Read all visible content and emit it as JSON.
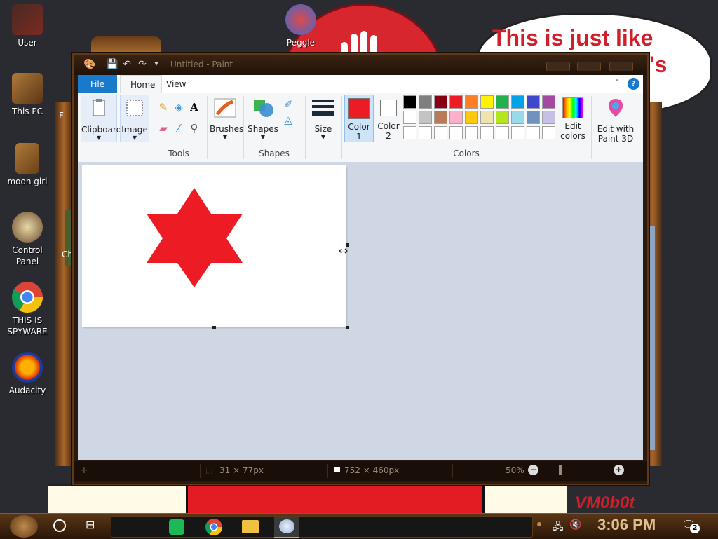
{
  "desktop": {
    "bubble_line1": "This is just like",
    "bubble_tail": "'s",
    "watermark": "VM0b0t",
    "icons": [
      {
        "label": "User"
      },
      {
        "label": "This PC"
      },
      {
        "label": "moon girl"
      },
      {
        "label": "Control Panel"
      },
      {
        "label": "THIS IS SPYWARE"
      },
      {
        "label": "Audacity"
      },
      {
        "label": "Peggle"
      }
    ],
    "partial_labels": [
      "F",
      "Ch"
    ]
  },
  "paint": {
    "title": "Untitled - Paint",
    "tabs": {
      "file": "File",
      "home": "Home",
      "view": "View"
    },
    "ribbon": {
      "clipboard": "Clipboard",
      "image": "Image",
      "tools_group": "Tools",
      "brushes": "Brushes",
      "shapes": "Shapes",
      "shapes_group": "Shapes",
      "size": "Size",
      "color1_line1": "Color",
      "color1_line2": "1",
      "color2_line1": "Color",
      "color2_line2": "2",
      "edit_colors_line1": "Edit",
      "edit_colors_line2": "colors",
      "paint3d_line1": "Edit with",
      "paint3d_line2": "Paint 3D",
      "colors_group": "Colors"
    },
    "palette_row1": [
      "#000000",
      "#7f7f7f",
      "#880015",
      "#ed1c24",
      "#ff7f27",
      "#fff200",
      "#22b14c",
      "#00a2e8",
      "#3f48cc",
      "#a349a4"
    ],
    "palette_row2": [
      "#ffffff",
      "#c3c3c3",
      "#b97a57",
      "#ffaec9",
      "#ffc90e",
      "#efe4b0",
      "#b5e61d",
      "#99d9ea",
      "#7092be",
      "#c8bfe7"
    ],
    "palette_row3": [
      "#ffffff",
      "#ffffff",
      "#ffffff",
      "#ffffff",
      "#ffffff",
      "#ffffff",
      "#ffffff",
      "#ffffff",
      "#ffffff",
      "#ffffff"
    ],
    "color1": "#ed1c24",
    "color2": "#ffffff",
    "status": {
      "cursor_pos": "31 × 77px",
      "canvas_size": "752 × 460px",
      "zoom": "50%"
    }
  },
  "taskbar": {
    "time": "3:06 PM",
    "notification_count": "2"
  }
}
